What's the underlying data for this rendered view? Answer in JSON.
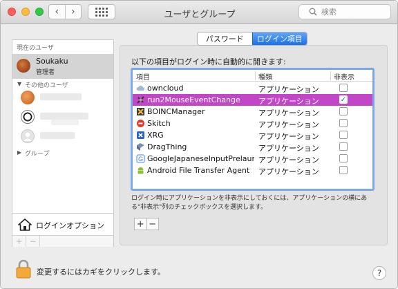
{
  "window": {
    "title": "ユーザとグループ"
  },
  "toolbar": {
    "back_glyph": "‹",
    "forward_glyph": "›",
    "search_placeholder": "検索"
  },
  "sidebar": {
    "current_header": "現在のユーザ",
    "current_user": {
      "name": "Soukaku",
      "role": "管理者"
    },
    "other_header": "その他のユーザ",
    "group_label": "グループ",
    "login_options_label": "ログインオプション",
    "add_glyph": "+",
    "remove_glyph": "−"
  },
  "tabs": {
    "password": "パスワード",
    "login_items": "ログイン項目",
    "active": "login_items"
  },
  "login_items": {
    "heading": "以下の項目がログイン時に自動的に開きます:",
    "columns": [
      "項目",
      "種類",
      "非表示"
    ],
    "rows": [
      {
        "name": "owncloud",
        "kind": "アプリケーション",
        "hidden": false,
        "selected": false,
        "icon": "cloud-icon"
      },
      {
        "name": "run2MouseEventChange",
        "kind": "アプリケーション",
        "hidden": true,
        "selected": true,
        "icon": "script-icon"
      },
      {
        "name": "BOINCManager",
        "kind": "アプリケーション",
        "hidden": false,
        "selected": false,
        "icon": "boinc-icon"
      },
      {
        "name": "Skitch",
        "kind": "アプリケーション",
        "hidden": false,
        "selected": false,
        "icon": "skitch-icon"
      },
      {
        "name": "XRG",
        "kind": "アプリケーション",
        "hidden": false,
        "selected": false,
        "icon": "xrg-icon"
      },
      {
        "name": "DragThing",
        "kind": "アプリケーション",
        "hidden": false,
        "selected": false,
        "icon": "dragthing-icon"
      },
      {
        "name": "GoogleJapaneseInputPrelaunch",
        "kind": "アプリケーション",
        "hidden": false,
        "selected": false,
        "icon": "google-input-icon"
      },
      {
        "name": "Android File Transfer Agent",
        "kind": "アプリケーション",
        "hidden": false,
        "selected": false,
        "icon": "android-icon"
      }
    ],
    "hint": "ログイン時にアプリケーションを非表示にしておくには、アプリケーションの横にある\"非表示\"列のチェックボックスを選択します。",
    "add_glyph": "+",
    "remove_glyph": "−"
  },
  "footer": {
    "lock_text": "変更するにはカギをクリックします。",
    "help_glyph": "?"
  },
  "colors": {
    "selection": "#c247c7",
    "accent": "#1a71e6",
    "table_focus": "#7aa8ea"
  }
}
